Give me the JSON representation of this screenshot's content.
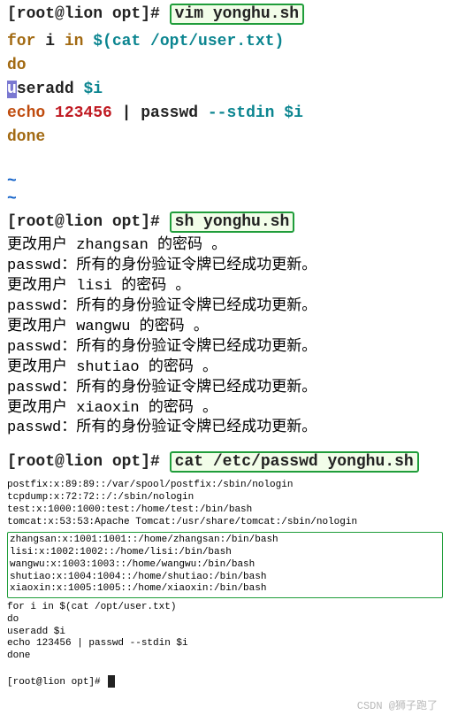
{
  "prompt": "[root@lion opt]#",
  "cmd1": "vim yonghu.sh",
  "cmd2": "sh yonghu.sh",
  "cmd3": "cat /etc/passwd yonghu.sh",
  "script": {
    "for_kw": "for",
    "var": " i ",
    "in_kw": "in",
    "subst": " $(cat /opt/user.txt)",
    "do_kw": "do",
    "useradd_u": "u",
    "useradd_rest": "seradd ",
    "dollar_i": "$i",
    "echo_kw": "echo",
    "pw_num": " 123456 ",
    "pipe_passwd": "| passwd ",
    "stdin_flag": "--stdin ",
    "done_kw": "done"
  },
  "tilde": "~",
  "output": [
    "更改用户 zhangsan 的密码 。",
    "passwd：所有的身份验证令牌已经成功更新。",
    "更改用户 lisi 的密码 。",
    "passwd：所有的身份验证令牌已经成功更新。",
    "更改用户 wangwu 的密码 。",
    "passwd：所有的身份验证令牌已经成功更新。",
    "更改用户 shutiao 的密码 。",
    "passwd：所有的身份验证令牌已经成功更新。",
    "更改用户 xiaoxin 的密码 。",
    "passwd：所有的身份验证令牌已经成功更新。"
  ],
  "passwd_head": [
    "postfix:x:89:89::/var/spool/postfix:/sbin/nologin",
    "tcpdump:x:72:72::/:/sbin/nologin",
    "test:x:1000:1000:test:/home/test:/bin/bash",
    "tomcat:x:53:53:Apache Tomcat:/usr/share/tomcat:/sbin/nologin"
  ],
  "passwd_users": [
    "zhangsan:x:1001:1001::/home/zhangsan:/bin/bash",
    "lisi:x:1002:1002::/home/lisi:/bin/bash",
    "wangwu:x:1003:1003::/home/wangwu:/bin/bash",
    "shutiao:x:1004:1004::/home/shutiao:/bin/bash",
    "xiaoxin:x:1005:1005::/home/xiaoxin:/bin/bash"
  ],
  "tail_script": [
    "for i in $(cat /opt/user.txt)",
    "do",
    "useradd $i",
    "echo 123456 | passwd --stdin $i",
    "done"
  ],
  "final_prompt": "[root@lion opt]# ",
  "watermark": "CSDN @狮子跑了"
}
